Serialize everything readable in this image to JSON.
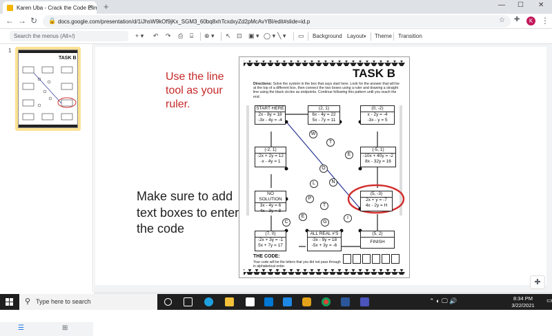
{
  "browser": {
    "tab_title": "Karen Uba - Crack the Code Elim",
    "new_tab": "+",
    "url": "docs.google.com/presentation/d/1iJhsW9kOf9jKx_SGM3_60bq8xhTcxdxyZd2pMcAvYBl/edit#slide=id.p",
    "avatar_letter": "K"
  },
  "toolbar": {
    "menu_search_placeholder": "Search the menus (Alt+/)",
    "background": "Background",
    "layout": "Layout",
    "theme": "Theme",
    "transition": "Transition"
  },
  "filmstrip": {
    "slide_number": "1"
  },
  "slide": {
    "note_ruler": "Use the line tool as your ruler.",
    "note_code": "Make sure to add text boxes to enter the code",
    "worksheet": {
      "title": "TASK B",
      "directions_label": "Directions:",
      "directions": "Solve the system in the box that says start here. Look for the answer that will be at the top of a different box, then connect the two boxes using a ruler and drawing a straight line using the black circles as endpoints. Continue following this pattern until you reach the end.",
      "boxes": [
        {
          "id": "start",
          "head": "START HERE",
          "l1": "2x - 8y = 18",
          "l2": "-3x - 4y = -4"
        },
        {
          "id": "b2",
          "head": "(2, 1)",
          "l1": "6x - 4y = 22",
          "l2": "5x - 7y = 11"
        },
        {
          "id": "b3",
          "head": "(0, -2)",
          "l1": "x - 2y = -4",
          "l2": "-3x - y = 5"
        },
        {
          "id": "b4",
          "head": "(-2, 1)",
          "l1": "-2x + 2y = 12",
          "l2": "-x - 4y = 1"
        },
        {
          "id": "b5",
          "head": "(-5, 1)",
          "l1": "-10x + 40y = -2",
          "l2": "8x - 32y = 16"
        },
        {
          "id": "b6",
          "head": "NO SOLUTION",
          "l1": "3x - 4y = 6",
          "l2": "4x - 3y = 8"
        },
        {
          "id": "b7",
          "head": "(5, -3)",
          "l1": "2x + y = -7",
          "l2": "4x - 2y = H"
        },
        {
          "id": "b8",
          "head": "(7, 0)",
          "l1": "-2x + 3y = -1",
          "l2": "5x + 7y = 17"
        },
        {
          "id": "b9",
          "head": "ALL REAL #'S",
          "l1": "-3x - 9y = 18",
          "l2": "-5x + 3y = -6"
        },
        {
          "id": "b10",
          "head": "(5, 2)",
          "l1": "FINISH",
          "l2": ""
        }
      ],
      "letters": [
        "W",
        "T",
        "E",
        "O",
        "L",
        "P",
        "T",
        "E",
        "C",
        "G",
        "I",
        "N"
      ],
      "code_label": "THE CODE:",
      "code_text": "Your code will be the letters that you did not pass through in alphabetical order."
    }
  },
  "taskbar": {
    "search_placeholder": "Type here to search",
    "time": "8:34 PM",
    "date": "3/22/2021"
  },
  "colors": {
    "note_red": "#c62828",
    "circle_red": "#d32f2f",
    "line_blue": "#283593",
    "thumb_highlight": "#fde293"
  }
}
